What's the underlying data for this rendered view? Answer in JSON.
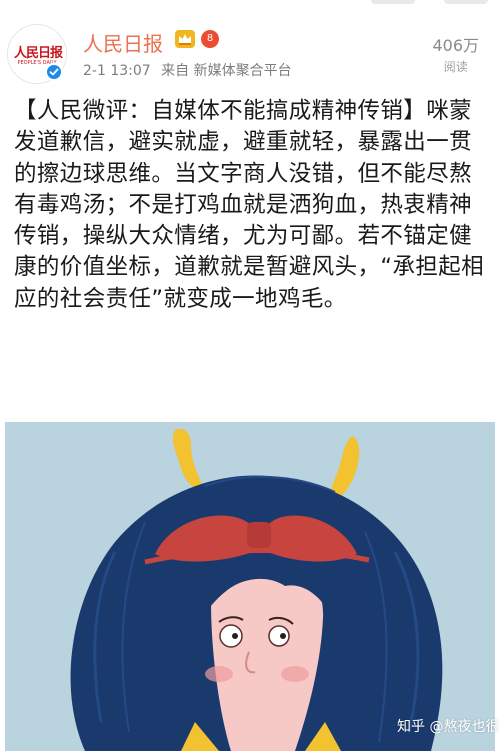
{
  "post": {
    "username": "人民日报",
    "level_badge": "8",
    "time": "2-1 13:07",
    "source": "来自 新媒体聚合平台",
    "views_count": "406万",
    "views_label": "阅读",
    "text": "【人民微评：自媒体不能搞成精神传销】咪蒙发道歉信，避实就虚，避重就轻，暴露出一贯的擦边球思维。当文字商人没错，但不能尽熬有毒鸡汤；不是打鸡血就是洒狗血，热衷精神传销，操纵大众情绪，尤为可鄙。若不锚定健康的价值坐标，道歉就是暂避风头，“承担起相应的社会责任”就变成一地鸡毛。"
  },
  "avatar_logo": {
    "text": "人民日报",
    "sub": "PEOPLE'S DAILY"
  },
  "watermark": "知乎 @熬夜也很宅",
  "colors": {
    "username": "#eb7350",
    "illustration_bg": "#b9d3df",
    "hair": "#1a3a6e",
    "bow": "#c8443f",
    "horns": "#f2c230",
    "skin": "#f7c9c6"
  },
  "icons": {
    "verified": "verified-check-icon",
    "crown": "crown-badge-icon"
  }
}
